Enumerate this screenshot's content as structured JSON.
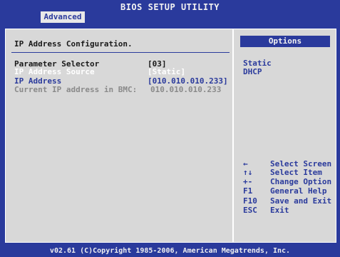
{
  "window": {
    "title": "BIOS SETUP UTILITY"
  },
  "tabs": [
    {
      "label": "Advanced",
      "active": true
    }
  ],
  "main": {
    "section_title": "IP Address Configuration.",
    "rows": [
      {
        "label": "Parameter Selector",
        "value": "[03]"
      },
      {
        "label": "IP Address Source",
        "value": "[Static]"
      },
      {
        "label": "IP Address",
        "value": "[010.010.010.233]"
      },
      {
        "label": "Current IP address in BMC:",
        "value": "010.010.010.233"
      }
    ]
  },
  "options": {
    "header": "Options",
    "items": [
      "Static",
      "DHCP"
    ]
  },
  "help": [
    {
      "key": "←",
      "desc": "Select Screen"
    },
    {
      "key": "↑↓",
      "desc": "Select Item"
    },
    {
      "key": "+-",
      "desc": "Change Option"
    },
    {
      "key": "F1",
      "desc": "General Help"
    },
    {
      "key": "F10",
      "desc": "Save and Exit"
    },
    {
      "key": "ESC",
      "desc": "Exit"
    }
  ],
  "footer": "v02.61  (C)Copyright 1985-2006, American Megatrends, Inc.",
  "colors": {
    "background": "#2a3a9c",
    "panel": "#d8d8d8",
    "highlight_text": "#ffffff",
    "disabled_text": "#8a8a8a"
  }
}
